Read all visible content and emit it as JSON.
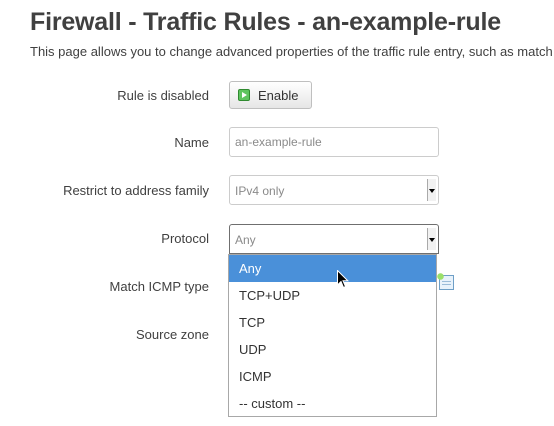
{
  "header": {
    "title": "Firewall - Traffic Rules - an-example-rule",
    "description": "This page allows you to change advanced properties of the traffic rule entry, such as match"
  },
  "form": {
    "rule_status": {
      "label": "Rule is disabled",
      "button_label": "Enable",
      "button_icon": "enable-icon"
    },
    "name": {
      "label": "Name",
      "value": "an-example-rule"
    },
    "address_family": {
      "label": "Restrict to address family",
      "value": "IPv4 only"
    },
    "protocol": {
      "label": "Protocol",
      "value": "Any",
      "options": [
        "Any",
        "TCP+UDP",
        "TCP",
        "UDP",
        "ICMP",
        "-- custom --"
      ],
      "highlighted_option": "Any",
      "highlight_color": "#4a90d9"
    },
    "icmp_type": {
      "label": "Match ICMP type",
      "add_icon": "add-list-item-icon"
    },
    "source_zone": {
      "label": "Source zone"
    }
  },
  "cursor": {
    "icon": "mouse-pointer-icon"
  }
}
